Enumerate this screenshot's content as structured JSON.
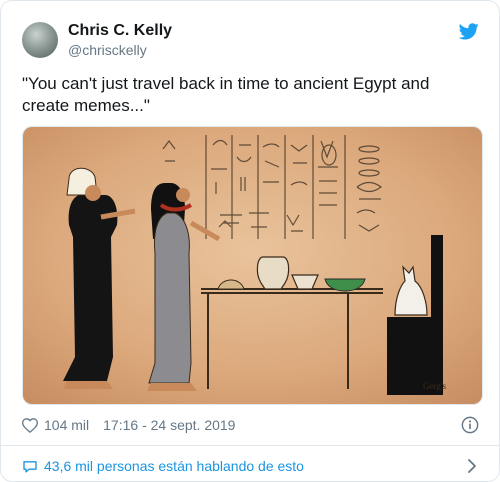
{
  "tweet": {
    "author_name": "Chris C. Kelly",
    "author_handle": "@chrisckelly",
    "text": "\"You can't just travel back in time to ancient Egypt and create memes...\"",
    "likes": "104 mil",
    "timestamp": "17:16 - 24 sept. 2019",
    "conversation": "43,6 mil personas están hablando de esto"
  },
  "icons": {
    "brand": "twitter-bird-icon",
    "like": "heart-icon",
    "info": "info-icon",
    "reply": "speech-bubble-icon",
    "more": "chevron-right-icon"
  },
  "colors": {
    "brand_blue": "#1da1f2",
    "link_blue": "#1b95e0",
    "muted": "#657786",
    "papyrus": "#d9a97c"
  },
  "image": {
    "signature": "Gerg's"
  }
}
